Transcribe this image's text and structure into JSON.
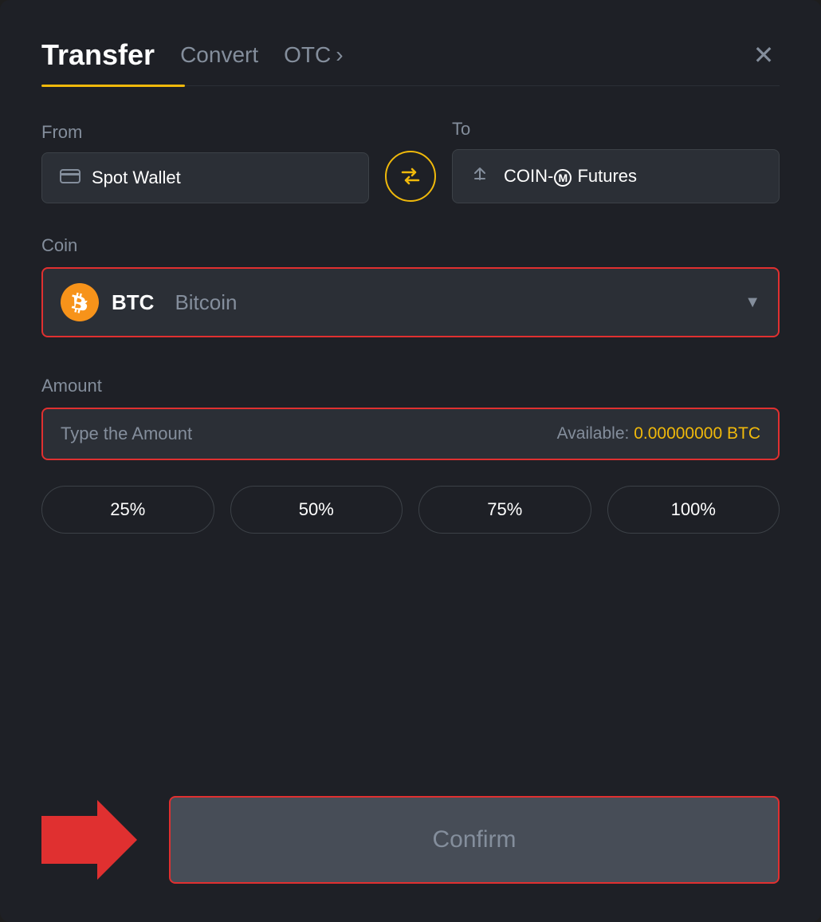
{
  "header": {
    "title": "Transfer",
    "nav_convert": "Convert",
    "nav_otc": "OTC",
    "nav_otc_chevron": "›",
    "close_symbol": "✕"
  },
  "from_section": {
    "label": "From",
    "wallet_icon": "▬",
    "wallet_name": "Spot Wallet"
  },
  "to_section": {
    "label": "To",
    "futures_icon": "↑",
    "futures_name": "COIN-Ⓜ Futures"
  },
  "swap": {
    "symbol": "⇄"
  },
  "coin_section": {
    "label": "Coin",
    "coin_symbol": "BTC",
    "coin_full": "Bitcoin",
    "btc_letter": "₿"
  },
  "amount_section": {
    "label": "Amount",
    "placeholder": "Type the Amount",
    "available_label": "Available:",
    "available_value": "0.00000000 BTC"
  },
  "percent_buttons": [
    "25%",
    "50%",
    "75%",
    "100%"
  ],
  "confirm": {
    "label": "Confirm"
  }
}
